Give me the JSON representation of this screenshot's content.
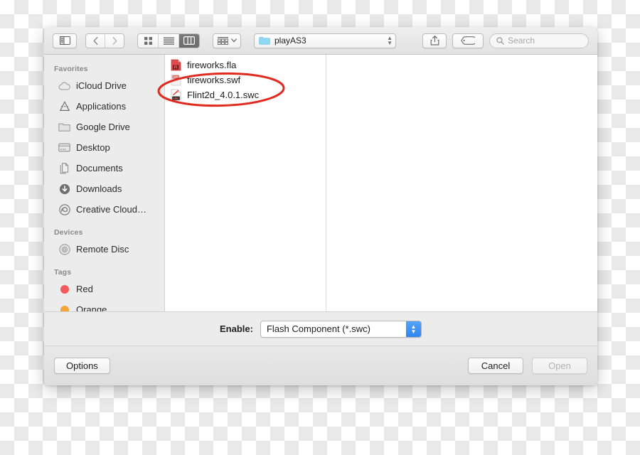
{
  "window": {
    "title": "",
    "toolbar": {
      "sidebar_toggle": "sidebar-toggle",
      "back_label": "‹",
      "forward_label": "›",
      "view_modes": [
        {
          "name": "icon-view",
          "selected": false
        },
        {
          "name": "list-view",
          "selected": false
        },
        {
          "name": "column-view",
          "selected": true
        }
      ],
      "arrange_label": "arrange-by",
      "path_label": "playAS3",
      "share_label": "share",
      "tag_label": "tag",
      "search_placeholder": "Search"
    }
  },
  "sidebar": {
    "sections": [
      {
        "header": "Favorites",
        "items": [
          {
            "label": "iCloud Drive",
            "icon": "icloud-icon"
          },
          {
            "label": "Applications",
            "icon": "applications-icon"
          },
          {
            "label": "Google Drive",
            "icon": "folder-icon"
          },
          {
            "label": "Desktop",
            "icon": "desktop-icon"
          },
          {
            "label": "Documents",
            "icon": "documents-icon"
          },
          {
            "label": "Downloads",
            "icon": "downloads-icon"
          },
          {
            "label": "Creative Cloud…",
            "icon": "creative-cloud-icon"
          }
        ]
      },
      {
        "header": "Devices",
        "items": [
          {
            "label": "Remote Disc",
            "icon": "disc-icon"
          }
        ]
      },
      {
        "header": "Tags",
        "items": [
          {
            "label": "Red",
            "icon": "tag-dot-icon",
            "color": "#f4595b"
          },
          {
            "label": "Orange",
            "icon": "tag-dot-icon",
            "color": "#f4a43a"
          }
        ]
      }
    ]
  },
  "files": [
    {
      "name": "fireworks.fla",
      "icon": "fla-file-icon"
    },
    {
      "name": "fireworks.swf",
      "icon": "swf-file-icon"
    },
    {
      "name": "Flint2d_4.0.1.swc",
      "icon": "swc-file-icon"
    }
  ],
  "enable_row": {
    "label": "Enable:",
    "value": "Flash Component (*.swc)"
  },
  "buttons": {
    "options": "Options",
    "cancel": "Cancel",
    "open": "Open"
  },
  "annotation": {
    "shape": "ellipse",
    "color": "#e02b20",
    "target": "Flint2d_4.0.1.swc"
  },
  "colors": {
    "accent_blue": "#2f86f0",
    "annotation_red": "#e02b20",
    "tag_red": "#f4595b",
    "tag_orange": "#f4a43a",
    "folder_blue": "#7fd3f2"
  }
}
